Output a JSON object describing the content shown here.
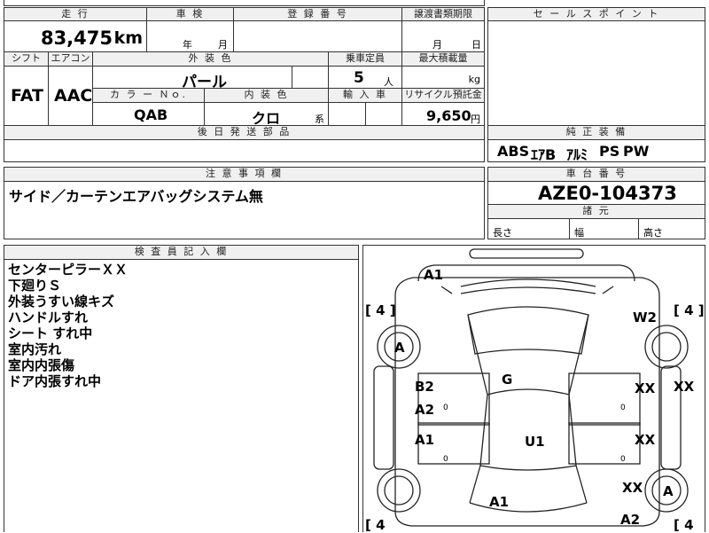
{
  "top": {
    "mileage_label": "走 行",
    "inspection_label": "車 検",
    "registration_label": "登 録 番 号",
    "transfer_deadline_label": "譲渡書類期限",
    "sales_point_label": "セ ー ル ス ポ イ ン ト",
    "mileage": "83,475",
    "mileage_unit": "km",
    "year_unit": "年",
    "month_unit": "月",
    "transfer_month": "月",
    "transfer_day": "日"
  },
  "row2": {
    "shift_label": "シフト",
    "aircon_label": "エアコン",
    "exterior_label": "外 装 色",
    "capacity_label": "乗車定員",
    "max_load_label": "最大積載量",
    "shift": "FAT",
    "aircon": "AAC",
    "exterior_color": "パール",
    "capacity": "5",
    "capacity_unit": "人",
    "load_unit": "kg"
  },
  "row3": {
    "color_no_label": "カ ラ ー Ｎｏ.",
    "interior_label": "内 装 色",
    "import_label": "輸 入 車",
    "recycle_label": "リサイクル預託金",
    "color_no": "QAB",
    "interior_color": "クロ",
    "interior_suffix": "系",
    "recycle_fee": "9,650",
    "recycle_unit": "円"
  },
  "parts": {
    "label": "後 日 発 送 部 品"
  },
  "equipment": {
    "label": "純 正 装 備",
    "items": [
      "ABS",
      "ｴｱB",
      "ｱﾙﾐ",
      "PS",
      "PW"
    ]
  },
  "notes": {
    "label": "注 意 事 項 欄",
    "text": "サイド／カーテンエアバッグシステム無"
  },
  "chassis": {
    "label": "車 台 番 号",
    "number": "AZE0-104373"
  },
  "specs": {
    "label": "諸 元",
    "length": "長さ",
    "width": "幅",
    "height": "高さ"
  },
  "inspector": {
    "label": "検 査 員 記 入 欄",
    "lines": [
      "センターピラーＸＸ",
      "下廻りＳ",
      "外装うすい線キズ",
      "ハンドルすれ",
      "シート すれ中",
      "室内汚れ",
      "室内内張傷",
      "ドア内張すれ中"
    ]
  },
  "diagram": {
    "labels": {
      "a1_top": "A1",
      "w2": "W2",
      "tire_fl": "[ 4 ]",
      "tire_fr": "[ 4 ]",
      "tire_rl": "[ 4",
      "tire_rr": "[ 4",
      "wheel_fl": "A",
      "wheel_rr": "A",
      "g": "G",
      "b2": "B2",
      "a2_left": "A2",
      "a1_left": "A1",
      "xx_right_front": "XX",
      "xx_pillar": "XX",
      "xx_right_rear": "XX",
      "xx_right_bottom": "XX",
      "u1": "U1",
      "a1_bottom": "A1",
      "a2_bottom": "A2",
      "mini_1": "0",
      "mini_2": "0",
      "mini_3": "0",
      "mini_4": "0"
    }
  }
}
